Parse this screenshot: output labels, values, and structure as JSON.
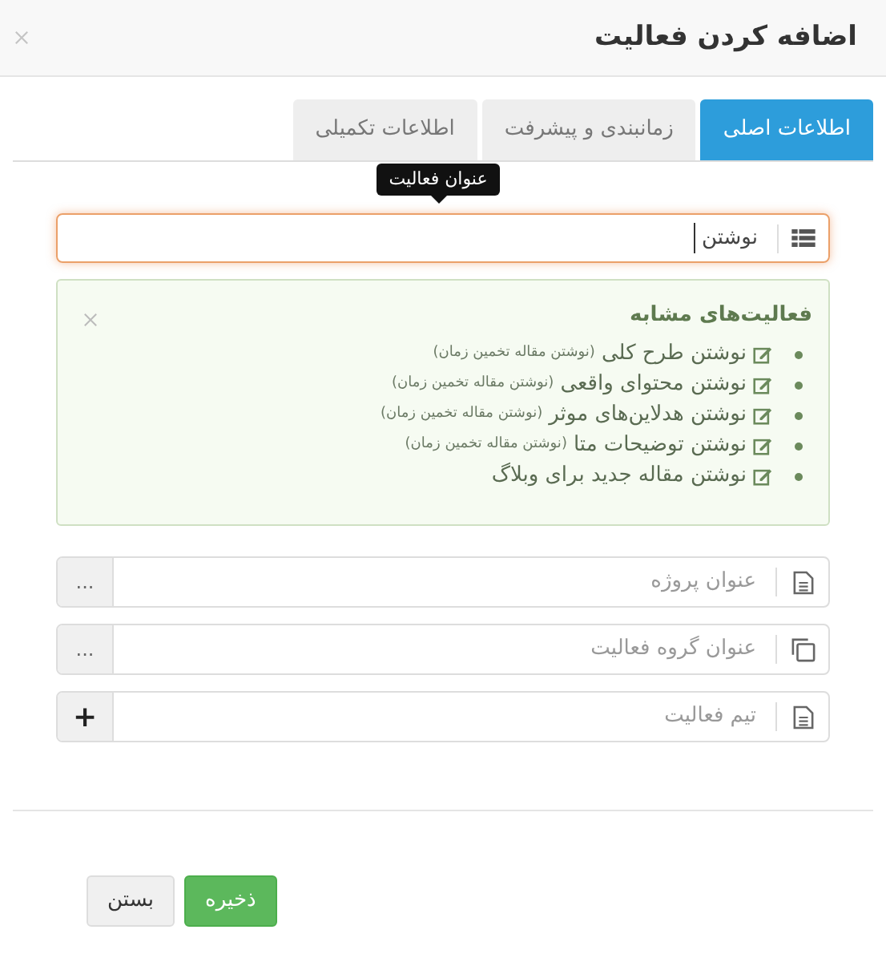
{
  "dialog": {
    "title": "اضافه کردن فعالیت"
  },
  "tabs": [
    {
      "label": "اطلاعات اصلی",
      "selected": true
    },
    {
      "label": "زمانبندی و پیشرفت",
      "selected": false
    },
    {
      "label": "اطلاعات تکمیلی",
      "selected": false
    }
  ],
  "title_field": {
    "tooltip": "عنوان فعالیت",
    "value": "نوشتن",
    "focused": true
  },
  "similar_activities": {
    "heading": "فعالیت‌های مشابه",
    "items": [
      {
        "title": "نوشتن طرح کلی",
        "note": "(نوشتن مقاله تخمین زمان)"
      },
      {
        "title": "نوشتن محتوای واقعی",
        "note": "(نوشتن مقاله تخمین زمان)"
      },
      {
        "title": "نوشتن هدلاین‌های موثر",
        "note": "(نوشتن مقاله تخمین زمان)"
      },
      {
        "title": "نوشتن توضیحات متا",
        "note": "(نوشتن مقاله تخمین زمان)"
      },
      {
        "title": "نوشتن مقاله جدید برای وبلاگ"
      }
    ]
  },
  "fields": [
    {
      "kind": "document",
      "placeholder": "عنوان پروژه",
      "button": {
        "kind": "more",
        "label": "..."
      }
    },
    {
      "kind": "copy",
      "placeholder": "عنوان گروه فعالیت",
      "button": {
        "kind": "more",
        "label": "..."
      }
    },
    {
      "kind": "document",
      "placeholder": "تیم فعالیت",
      "button": {
        "kind": "add",
        "label": "+"
      }
    }
  ],
  "buttons": [
    {
      "label": "ذخیره",
      "kind": "primary"
    },
    {
      "label": "بستن",
      "kind": "default"
    }
  ]
}
